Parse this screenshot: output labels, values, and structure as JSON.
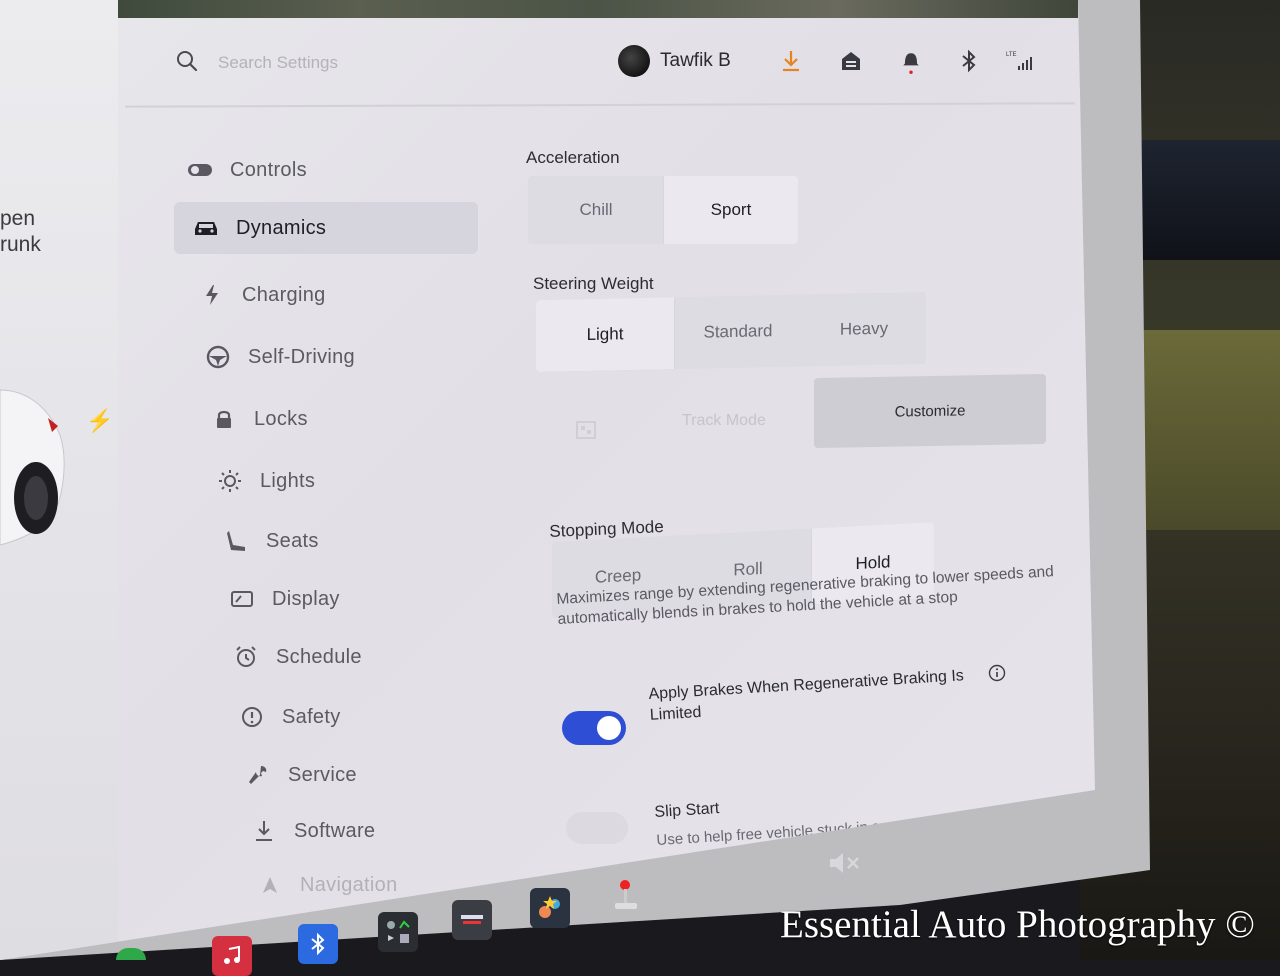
{
  "header": {
    "search_placeholder": "Search Settings",
    "username": "Tawfik B"
  },
  "car_panel": {
    "trunk_line1": "pen",
    "trunk_line2": "runk"
  },
  "sidebar": {
    "items": [
      {
        "label": "Controls",
        "icon": "toggle-icon"
      },
      {
        "label": "Dynamics",
        "icon": "car-icon",
        "active": true
      },
      {
        "label": "Charging",
        "icon": "bolt-icon"
      },
      {
        "label": "Self-Driving",
        "icon": "steering-wheel-icon"
      },
      {
        "label": "Locks",
        "icon": "lock-icon"
      },
      {
        "label": "Lights",
        "icon": "sun-icon"
      },
      {
        "label": "Seats",
        "icon": "seat-icon"
      },
      {
        "label": "Display",
        "icon": "display-icon"
      },
      {
        "label": "Schedule",
        "icon": "alarm-clock-icon"
      },
      {
        "label": "Safety",
        "icon": "alert-circle-icon"
      },
      {
        "label": "Service",
        "icon": "wrench-icon"
      },
      {
        "label": "Software",
        "icon": "download-icon"
      },
      {
        "label": "Navigation",
        "icon": "navigation-arrow-icon"
      }
    ]
  },
  "acceleration": {
    "title": "Acceleration",
    "options": [
      "Chill",
      "Sport"
    ],
    "selected": "Sport"
  },
  "steering": {
    "title": "Steering Weight",
    "options": [
      "Light",
      "Standard",
      "Heavy"
    ],
    "selected": "Light"
  },
  "track_mode": {
    "label": "Track Mode",
    "customize_label": "Customize"
  },
  "stopping": {
    "title": "Stopping Mode",
    "options": [
      "Creep",
      "Roll",
      "Hold"
    ],
    "selected": "Hold",
    "description": "Maximizes range by extending regenerative braking to lower speeds and automatically blends in brakes to hold the vehicle at a stop"
  },
  "apply_brakes": {
    "label": "Apply Brakes When Regenerative Braking Is Limited",
    "enabled": true
  },
  "slip_start": {
    "title": "Slip Start",
    "description": "Use to help free vehicle stuck in snow, sand, or mud",
    "enabled": false
  },
  "watermark": "Essential Auto Photography ©",
  "colors": {
    "toggle_on": "#2e4ed6",
    "download_accent": "#e8821e",
    "notification_dot": "#d22a2a"
  }
}
